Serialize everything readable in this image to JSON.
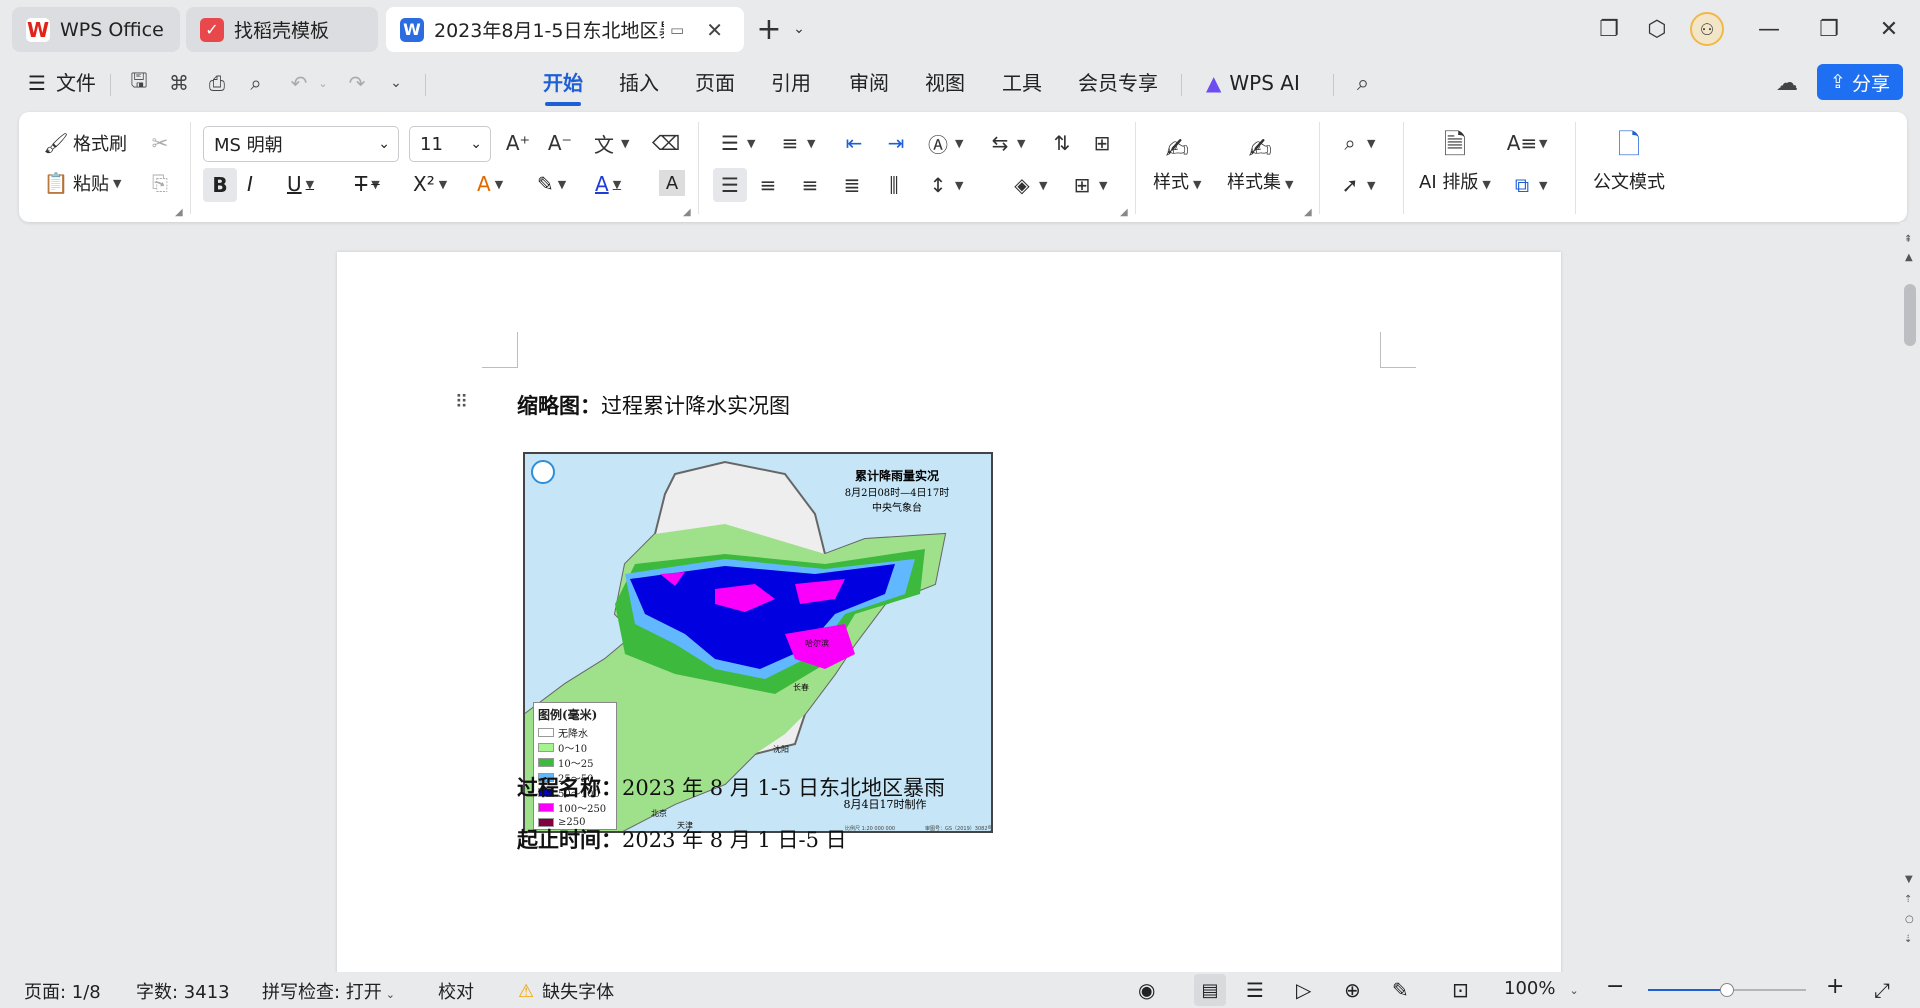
{
  "tabs": [
    {
      "label": "WPS Office",
      "icon": "wps-logo-icon"
    },
    {
      "label": "找稻壳模板",
      "icon": "docer-icon"
    },
    {
      "label": "2023年8月1-5日东北地区暴",
      "icon": "word-doc-icon"
    }
  ],
  "menu": {
    "file": "文件",
    "items": [
      "开始",
      "插入",
      "页面",
      "引用",
      "审阅",
      "视图",
      "工具",
      "会员专享"
    ],
    "active": "开始",
    "wps_ai": "WPS AI",
    "share": "分享"
  },
  "ribbon": {
    "format_painter": "格式刷",
    "paste": "粘贴",
    "font_name": "MS 明朝",
    "font_size": "11",
    "style": "样式",
    "style_set": "样式集",
    "ai_layout": "AI 排版",
    "official_mode": "公文模式"
  },
  "document": {
    "line1_label": "缩略图：",
    "line1_value": "过程累计降水实况图",
    "map_title1": "累计降雨量实况",
    "map_title2": "8月2日08时—4日17时",
    "map_title3": "中央气象台",
    "map_made": "8月4日17时制作",
    "legend_title": "图例(毫米)",
    "legend": [
      {
        "label": "无降水",
        "color": "#ffffff"
      },
      {
        "label": "0～10",
        "color": "#a6f28f"
      },
      {
        "label": "10～25",
        "color": "#3dba3d"
      },
      {
        "label": "25～50",
        "color": "#61b8ff"
      },
      {
        "label": "50～100",
        "color": "#0000e1"
      },
      {
        "label": "100～250",
        "color": "#fa00fa"
      },
      {
        "label": "≥250",
        "color": "#800040"
      }
    ],
    "city_beijing": "北京",
    "city_tianjin": "天津",
    "city_shenyang": "沈阳",
    "city_changchun": "长春",
    "city_harbin": "哈尔滨",
    "map_scale": "比例尺 1:20 000 000",
    "map_review": "审图号：GS（2019）3082号",
    "line2_label": "过程名称：",
    "line2_value": "2023 年 8 月 1-5 日东北地区暴雨",
    "line3_label": "起止时间：",
    "line3_value": "2023 年 8 月 1 日-5 日"
  },
  "status": {
    "page": "页面: 1/8",
    "words": "字数: 3413",
    "spell": "拼写检查: 打开",
    "proof": "校对",
    "missing_font": "缺失字体",
    "zoom": "100%",
    "zoom_level": 0.5
  }
}
